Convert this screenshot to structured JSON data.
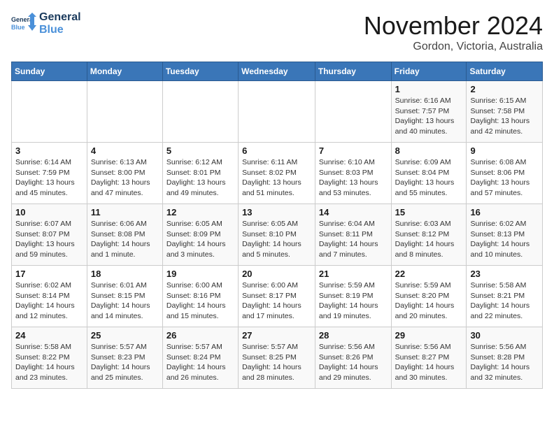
{
  "header": {
    "logo_line1": "General",
    "logo_line2": "Blue",
    "title": "November 2024",
    "subtitle": "Gordon, Victoria, Australia"
  },
  "weekdays": [
    "Sunday",
    "Monday",
    "Tuesday",
    "Wednesday",
    "Thursday",
    "Friday",
    "Saturday"
  ],
  "weeks": [
    [
      {
        "day": "",
        "info": ""
      },
      {
        "day": "",
        "info": ""
      },
      {
        "day": "",
        "info": ""
      },
      {
        "day": "",
        "info": ""
      },
      {
        "day": "",
        "info": ""
      },
      {
        "day": "1",
        "info": "Sunrise: 6:16 AM\nSunset: 7:57 PM\nDaylight: 13 hours\nand 40 minutes."
      },
      {
        "day": "2",
        "info": "Sunrise: 6:15 AM\nSunset: 7:58 PM\nDaylight: 13 hours\nand 42 minutes."
      }
    ],
    [
      {
        "day": "3",
        "info": "Sunrise: 6:14 AM\nSunset: 7:59 PM\nDaylight: 13 hours\nand 45 minutes."
      },
      {
        "day": "4",
        "info": "Sunrise: 6:13 AM\nSunset: 8:00 PM\nDaylight: 13 hours\nand 47 minutes."
      },
      {
        "day": "5",
        "info": "Sunrise: 6:12 AM\nSunset: 8:01 PM\nDaylight: 13 hours\nand 49 minutes."
      },
      {
        "day": "6",
        "info": "Sunrise: 6:11 AM\nSunset: 8:02 PM\nDaylight: 13 hours\nand 51 minutes."
      },
      {
        "day": "7",
        "info": "Sunrise: 6:10 AM\nSunset: 8:03 PM\nDaylight: 13 hours\nand 53 minutes."
      },
      {
        "day": "8",
        "info": "Sunrise: 6:09 AM\nSunset: 8:04 PM\nDaylight: 13 hours\nand 55 minutes."
      },
      {
        "day": "9",
        "info": "Sunrise: 6:08 AM\nSunset: 8:06 PM\nDaylight: 13 hours\nand 57 minutes."
      }
    ],
    [
      {
        "day": "10",
        "info": "Sunrise: 6:07 AM\nSunset: 8:07 PM\nDaylight: 13 hours\nand 59 minutes."
      },
      {
        "day": "11",
        "info": "Sunrise: 6:06 AM\nSunset: 8:08 PM\nDaylight: 14 hours\nand 1 minute."
      },
      {
        "day": "12",
        "info": "Sunrise: 6:05 AM\nSunset: 8:09 PM\nDaylight: 14 hours\nand 3 minutes."
      },
      {
        "day": "13",
        "info": "Sunrise: 6:05 AM\nSunset: 8:10 PM\nDaylight: 14 hours\nand 5 minutes."
      },
      {
        "day": "14",
        "info": "Sunrise: 6:04 AM\nSunset: 8:11 PM\nDaylight: 14 hours\nand 7 minutes."
      },
      {
        "day": "15",
        "info": "Sunrise: 6:03 AM\nSunset: 8:12 PM\nDaylight: 14 hours\nand 8 minutes."
      },
      {
        "day": "16",
        "info": "Sunrise: 6:02 AM\nSunset: 8:13 PM\nDaylight: 14 hours\nand 10 minutes."
      }
    ],
    [
      {
        "day": "17",
        "info": "Sunrise: 6:02 AM\nSunset: 8:14 PM\nDaylight: 14 hours\nand 12 minutes."
      },
      {
        "day": "18",
        "info": "Sunrise: 6:01 AM\nSunset: 8:15 PM\nDaylight: 14 hours\nand 14 minutes."
      },
      {
        "day": "19",
        "info": "Sunrise: 6:00 AM\nSunset: 8:16 PM\nDaylight: 14 hours\nand 15 minutes."
      },
      {
        "day": "20",
        "info": "Sunrise: 6:00 AM\nSunset: 8:17 PM\nDaylight: 14 hours\nand 17 minutes."
      },
      {
        "day": "21",
        "info": "Sunrise: 5:59 AM\nSunset: 8:19 PM\nDaylight: 14 hours\nand 19 minutes."
      },
      {
        "day": "22",
        "info": "Sunrise: 5:59 AM\nSunset: 8:20 PM\nDaylight: 14 hours\nand 20 minutes."
      },
      {
        "day": "23",
        "info": "Sunrise: 5:58 AM\nSunset: 8:21 PM\nDaylight: 14 hours\nand 22 minutes."
      }
    ],
    [
      {
        "day": "24",
        "info": "Sunrise: 5:58 AM\nSunset: 8:22 PM\nDaylight: 14 hours\nand 23 minutes."
      },
      {
        "day": "25",
        "info": "Sunrise: 5:57 AM\nSunset: 8:23 PM\nDaylight: 14 hours\nand 25 minutes."
      },
      {
        "day": "26",
        "info": "Sunrise: 5:57 AM\nSunset: 8:24 PM\nDaylight: 14 hours\nand 26 minutes."
      },
      {
        "day": "27",
        "info": "Sunrise: 5:57 AM\nSunset: 8:25 PM\nDaylight: 14 hours\nand 28 minutes."
      },
      {
        "day": "28",
        "info": "Sunrise: 5:56 AM\nSunset: 8:26 PM\nDaylight: 14 hours\nand 29 minutes."
      },
      {
        "day": "29",
        "info": "Sunrise: 5:56 AM\nSunset: 8:27 PM\nDaylight: 14 hours\nand 30 minutes."
      },
      {
        "day": "30",
        "info": "Sunrise: 5:56 AM\nSunset: 8:28 PM\nDaylight: 14 hours\nand 32 minutes."
      }
    ]
  ]
}
